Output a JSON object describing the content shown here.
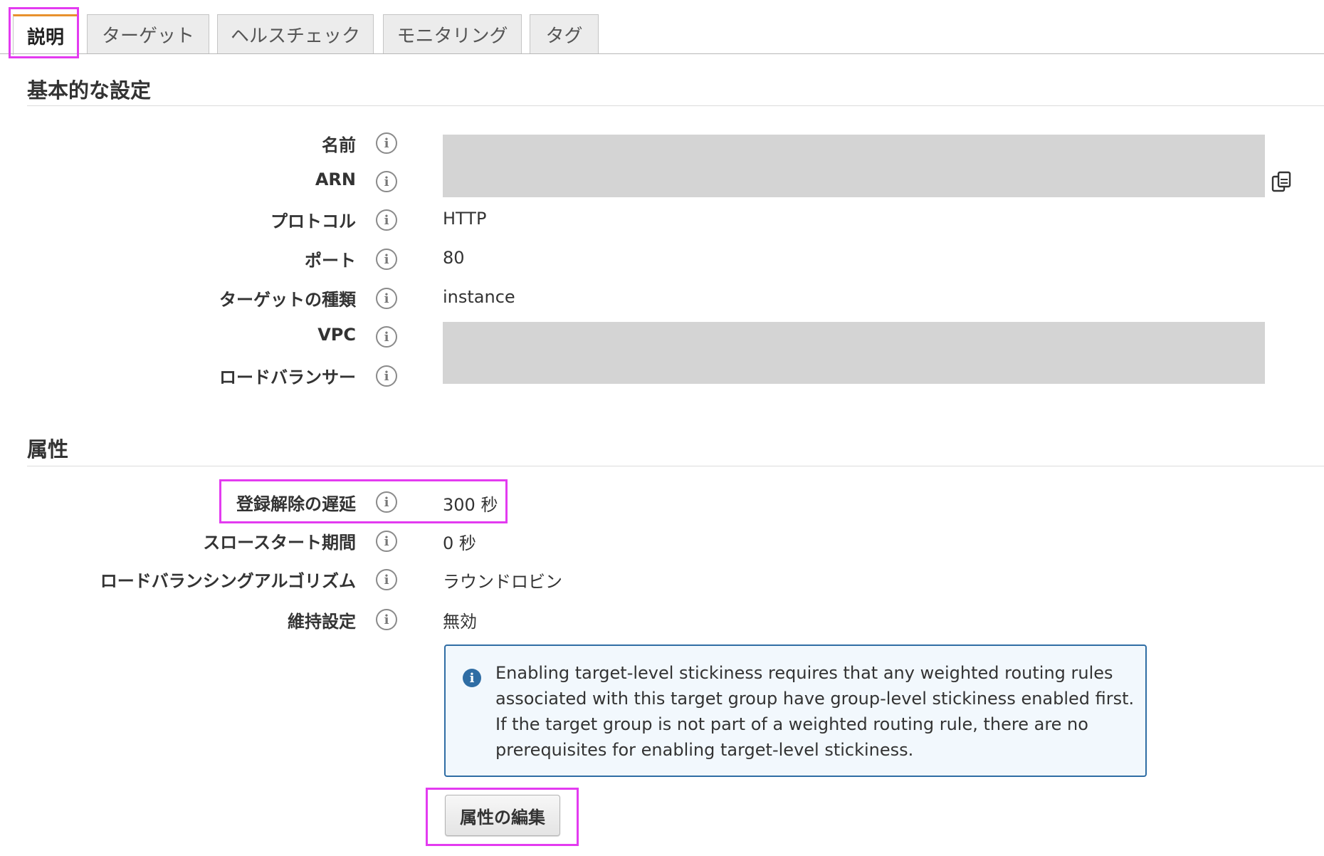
{
  "tabs": [
    {
      "label": "説明",
      "active": true
    },
    {
      "label": "ターゲット",
      "active": false
    },
    {
      "label": "ヘルスチェック",
      "active": false
    },
    {
      "label": "モニタリング",
      "active": false
    },
    {
      "label": "タグ",
      "active": false
    }
  ],
  "basic": {
    "title": "基本的な設定",
    "rows": [
      {
        "label": "名前",
        "value": ""
      },
      {
        "label": "ARN",
        "value": ""
      },
      {
        "label": "プロトコル",
        "value": "HTTP"
      },
      {
        "label": "ポート",
        "value": "80"
      },
      {
        "label": "ターゲットの種類",
        "value": "instance"
      },
      {
        "label": "VPC",
        "value": ""
      },
      {
        "label": "ロードバランサー",
        "value": ""
      }
    ]
  },
  "attributes": {
    "title": "属性",
    "rows": [
      {
        "label": "登録解除の遅延",
        "value": "300 秒"
      },
      {
        "label": "スロースタート期間",
        "value": "0 秒"
      },
      {
        "label": "ロードバランシングアルゴリズム",
        "value": "ラウンドロビン"
      },
      {
        "label": "維持設定",
        "value": "無効"
      }
    ],
    "notice": "Enabling target-level stickiness requires that any weighted routing rules associated with this target group have group-level stickiness enabled first. If the target group is not part of a weighted routing rule, there are no prerequisites for enabling target-level stickiness.",
    "edit_button": "属性の編集"
  },
  "info_glyph": "i",
  "colors": {
    "highlight": "#e33bf0",
    "active_tab_accent": "#e8912d",
    "notice_border": "#2f6da4"
  }
}
